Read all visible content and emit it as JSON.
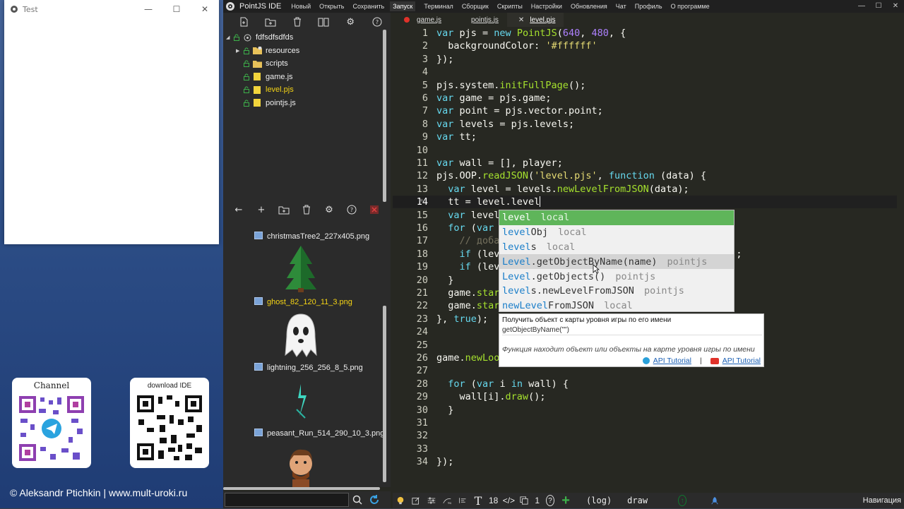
{
  "test_window": {
    "title": "Test"
  },
  "promo": {
    "channel_label": "Channel",
    "download_label": "download IDE",
    "credit": "© Aleksandr Ptichkin | www.mult-uroki.ru"
  },
  "menubar": {
    "title": "PointJS IDE",
    "items": [
      "Новый",
      "Открыть",
      "Сохранить",
      "Запуск",
      "Терминал",
      "Сборщик",
      "Скрипты",
      "Настройки",
      "Обновления",
      "Чат",
      "Профиль",
      "О программе"
    ],
    "active": "Запуск"
  },
  "project": {
    "root": "fdfsdfsdfds",
    "items": [
      {
        "name": "resources",
        "type": "folder",
        "expandable": true
      },
      {
        "name": "scripts",
        "type": "folder",
        "expandable": false
      },
      {
        "name": "game.js",
        "type": "file",
        "expandable": false
      },
      {
        "name": "level.pjs",
        "type": "file",
        "expandable": false,
        "selected": true
      },
      {
        "name": "pointjs.js",
        "type": "file",
        "expandable": false
      }
    ]
  },
  "resources": [
    {
      "name": "christmasTree2_227x405.png",
      "preview": "tree"
    },
    {
      "name": "ghost_82_120_11_3.png",
      "preview": "ghost",
      "selected": true
    },
    {
      "name": "lightning_256_256_8_5.png",
      "preview": "lightning"
    },
    {
      "name": "peasant_Run_514_290_10_3.png",
      "preview": "peasant"
    }
  ],
  "tabs": [
    {
      "label": "game.js",
      "modified": true
    },
    {
      "label": "pointjs.js"
    },
    {
      "label": "level.pjs",
      "closable": true,
      "active": true
    }
  ],
  "editor": {
    "current_line": 14
  },
  "autocomplete": {
    "items": [
      {
        "hl": "level",
        "rest": "",
        "meta": "local",
        "selected": true
      },
      {
        "hl": "level",
        "rest": "Obj",
        "meta": "local"
      },
      {
        "hl": "level",
        "rest": "s",
        "meta": "local"
      },
      {
        "hl": "Level",
        "rest": ".getObjectByName(name)",
        "meta": "pointjs",
        "hover": true
      },
      {
        "hl": "Level",
        "rest": ".getObjects()",
        "meta": "pointjs"
      },
      {
        "hl": "level",
        "rest": "s.newLevelFromJSON",
        "meta": "pointjs"
      },
      {
        "hl": "newLevel",
        "rest": "FromJSON",
        "meta": "local"
      }
    ]
  },
  "doc": {
    "title": "Получить объект с карты уровня игры по его имени",
    "signature": "getObjectByName(\"\")",
    "description": "Функция находит объект или объекты на карте уровня игры по имени",
    "link1": "API Tutorial",
    "link2": "API Tutorial"
  },
  "statusbar": {
    "font_size": "18",
    "count": "1",
    "log": "(log)",
    "draw": "draw",
    "nav": "Навигация"
  },
  "colors": {
    "accent_yellow": "#f5d415",
    "editor_bg": "#272822",
    "selected_green": "#5fb55a"
  }
}
